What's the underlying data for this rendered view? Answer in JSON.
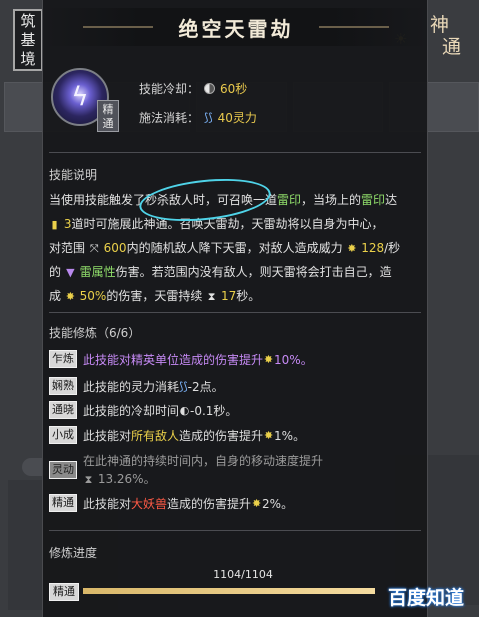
{
  "realm": {
    "chars": [
      "筑",
      "基",
      "境"
    ]
  },
  "divine_icon": {
    "glyph1": "神",
    "glyph2": "通",
    "sun": "☀"
  },
  "skill": {
    "title": "绝空天雷劫",
    "grade_label": "精通",
    "icon_glyph": "ϟ",
    "cooldown_label": "技能冷却：",
    "cooldown_value": "60秒",
    "cost_label": "施法消耗：",
    "cost_icon": "⟆⟆",
    "cost_value": "40灵力"
  },
  "description": {
    "title": "技能说明",
    "line1_a": "当使用技能触发了秒杀敌人时，可召唤一道",
    "line1_b": "雷印",
    "line1_c": "，当场上的",
    "line1_d": "雷印",
    "line1_e": "达",
    "line2_icon": "▮",
    "line2_a": "3",
    "line2_b": "道时可施展此神通。召唤天雷劫，天雷劫将以自身为中心，",
    "line3_a": "对范围 ",
    "line3_icon": "⤧",
    "line3_b": "600",
    "line3_c": "内的随机敌人降下天雷，对敌人造成威力 ",
    "line3_icon2": "✸",
    "line3_d": "128",
    "line3_e": "/秒",
    "line4_a": "的 ",
    "line4_icon": "▼",
    "line4_b": "雷属性",
    "line4_c": "伤害。若范围内没有敌人，则天雷将会打击自己，造",
    "line5_a": "成 ",
    "line5_icon": "✸",
    "line5_b": "50%",
    "line5_c": "的伤害，天雷持续 ",
    "line5_icon2": "⧗",
    "line5_d": "17",
    "line5_e": "秒。"
  },
  "mods": {
    "title": "技能修炼（6/6）",
    "rows": [
      {
        "badge": "乍炼",
        "pre": "此技能对精英单位造成的伤害提升 ",
        "icon": "✸",
        "val": "10%。"
      },
      {
        "badge": "娴熟",
        "pre": "此技能的灵力消耗 ",
        "icon": "⟆⟆",
        "val": "-2点。"
      },
      {
        "badge": "通晓",
        "pre": "此技能的冷却时间 ",
        "icon": "◐",
        "val": "-0.1秒。"
      },
      {
        "badge": "小成",
        "pre": "此技能对",
        "hl": "所有敌人",
        "mid": "造成的伤害提升 ",
        "icon": "✸",
        "val": "1%。"
      },
      {
        "badge": "灵动",
        "pre": "在此神通的持续时间内，自身的移动速度提升",
        "icon": "⧗",
        "val": "13.26%。"
      },
      {
        "badge": "精通",
        "pre": "此技能对",
        "hl": "大妖兽",
        "mid": "造成的伤害提升 ",
        "icon": "✸",
        "val": "2%。"
      }
    ]
  },
  "progress": {
    "title": "修炼进度",
    "value_text": "1104/1104",
    "fraction": 1.0,
    "badge": "精通"
  },
  "watermark": "百度知道"
}
